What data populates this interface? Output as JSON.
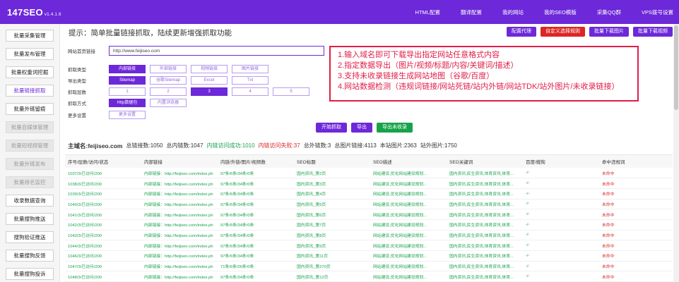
{
  "header": {
    "brand": "147SEO",
    "version": "v1.4.1.6",
    "nav": [
      "HTML配置",
      "翻译配置",
      "我的网站",
      "我的SEO模版",
      "采集QQ群",
      "VPS拨号设置"
    ]
  },
  "sidebar": {
    "items": [
      {
        "label": "批量采集管理",
        "state": "normal"
      },
      {
        "label": "批量发布管理",
        "state": "normal"
      },
      {
        "label": "批量权重词挖掘",
        "state": "normal"
      },
      {
        "label": "批量链接抓取",
        "state": "active"
      },
      {
        "label": "批量外链留痕",
        "state": "normal"
      },
      {
        "label": "批量自媒体管理",
        "state": "disabled"
      },
      {
        "label": "批量短视频管理",
        "state": "disabled"
      },
      {
        "label": "批量外链发布",
        "state": "disabled"
      },
      {
        "label": "批量排名监控",
        "state": "disabled"
      },
      {
        "label": "收录数据查询",
        "state": "normal"
      },
      {
        "label": "批量搜狗推送",
        "state": "normal"
      },
      {
        "label": "搜狗验证推送",
        "state": "normal"
      },
      {
        "label": "批量搜狗反馈",
        "state": "normal"
      },
      {
        "label": "批量搜狗投诉",
        "state": "normal"
      }
    ]
  },
  "main": {
    "hint": "提示：简单批量链接抓取，陆续更新增强抓取功能",
    "actions": [
      "配置代理",
      "自定义选择规则",
      "批量下载图片",
      "批量下载视频"
    ],
    "form": {
      "url_label": "网站首页链接",
      "url_value": "http://www.feijiseo.com",
      "fetch_type_label": "抓取类型",
      "fetch_types": [
        "内部链接",
        "外部链接",
        "视频链接",
        "图片链接"
      ],
      "export_type_label": "导出类型",
      "export_types": [
        "Sitemap",
        "谷歌Sitemap",
        "Excel",
        "Txt"
      ],
      "layers_label": "抓取层数",
      "layers": [
        "1",
        "2",
        "3",
        "4",
        "5"
      ],
      "method_label": "抓取方式",
      "methods": [
        "Http数据包",
        "内置浏览器"
      ],
      "more_label": "更多设置",
      "more_button": "更多设置"
    },
    "callout": [
      "1.输入域名即可下载导出指定网站任意格式内容",
      "2.指定数据导出（图片/视频/标题/内容/关键词/描述）",
      "3.支持未收录链接生成网站地图（谷歌/百度）",
      "4.网站数据检测（违规词链接/网站死链/站内外链/网站TDK/站外图片/未收录链接）"
    ],
    "run_buttons": [
      "开始抓取",
      "导出",
      "导出未收录"
    ],
    "stats": {
      "domain": "主域名:feijiseo.com",
      "total": "总链接数:1050",
      "internal": "总内链数:1047",
      "ok": "内链访问成功:1010",
      "fail": "内链访问失败:37",
      "external": "总外链数:3",
      "images": "总图片链接:4113",
      "local_images": "本站图片:2363",
      "external_images": "站外图片:1750"
    },
    "table": {
      "columns": [
        "序号/层数/访问/状态",
        "内部链接",
        "内链/外链/图片/视频数",
        "SEO标题",
        "SEO描述",
        "SEO关键词",
        "百度/搜狗",
        "命中违规词"
      ],
      "rows": [
        [
          "1037/3/已访问/200",
          "内部链接：http://feijiseo.com/index.ph",
          "97条/6条/34条/0条",
          "国内资讯_第2页",
          "网站建设,优化网站建设规划...",
          "国内资讯,民生资讯,体育资讯,体育...",
          "-/-",
          "未命中"
        ],
        [
          "1038/3/已访问/200",
          "内部链接：http://feijiseo.com/index.ph",
          "97条/6条/34条/0条",
          "国内资讯_第3页",
          "网站建设,优化网站建设规划...",
          "国内资讯,民生资讯,体育资讯,体育...",
          "-/-",
          "未命中"
        ],
        [
          "1039/3/已访问/200",
          "内部链接：http://feijiseo.com/index.ph",
          "97条/6条/34条/0条",
          "国内资讯_第4页",
          "网站建设,优化网站建设规划...",
          "国内资讯,民生资讯,体育资讯,体育...",
          "-/-",
          "未命中"
        ],
        [
          "1040/3/已访问/200",
          "内部链接：http://feijiseo.com/index.ph",
          "97条/6条/34条/0条",
          "国内资讯_第5页",
          "网站建设,优化网站建设规划...",
          "国内资讯,民生资讯,体育资讯,体育...",
          "-/-",
          "未命中"
        ],
        [
          "1041/3/已访问/200",
          "内部链接：http://feijiseo.com/index.ph",
          "97条/6条/34条/0条",
          "国内资讯_第6页",
          "网站建设,优化网站建设规划...",
          "国内资讯,民生资讯,体育资讯,体育...",
          "-/-",
          "未命中"
        ],
        [
          "1042/3/已访问/200",
          "内部链接：http://feijiseo.com/index.ph",
          "97条/6条/34条/0条",
          "国内资讯_第7页",
          "网站建设,优化网站建设规划...",
          "国内资讯,民生资讯,体育资讯,体育...",
          "-/-",
          "未命中"
        ],
        [
          "1043/3/已访问/200",
          "内部链接：http://feijiseo.com/index.ph",
          "97条/6条/34条/0条",
          "国内资讯_第8页",
          "网站建设,优化网站建设规划...",
          "国内资讯,民生资讯,体育资讯,体育...",
          "-/-",
          "未命中"
        ],
        [
          "1044/3/已访问/200",
          "内部链接：http://feijiseo.com/index.ph",
          "97条/6条/34条/0条",
          "国内资讯_第9页",
          "网站建设,优化网站建设规划...",
          "国内资讯,民生资讯,体育资讯,体育...",
          "-/-",
          "未命中"
        ],
        [
          "1046/3/已访问/200",
          "内部链接：http://feijiseo.com/index.ph",
          "97条/6条/34条/0条",
          "国内资讯_第11页",
          "网站建设,优化网站建设规划...",
          "国内资讯,民生资讯,体育资讯,体育...",
          "-/-",
          "未命中"
        ],
        [
          "1047/3/已访问/200",
          "内部链接：http://feijiseo.com/index.ph",
          "71条/6条/26条/0条",
          "国内资讯_第270页",
          "网站建设,优化网站建设规划...",
          "国内资讯,民生资讯,体育资讯,体育...",
          "-/-",
          "未命中"
        ],
        [
          "1048/3/已访问/200",
          "内部链接：http://feijiseo.com/index.ph",
          "97条/6条/34条/0条",
          "国内资讯_第12页",
          "网站建设,优化网站建设规划...",
          "国内资讯,民生资讯,体育资讯,体育...",
          "-/-",
          "未命中"
        ]
      ]
    }
  },
  "colors": {
    "accent": "#6d28d9",
    "success": "#16a34a",
    "danger": "#dc2626"
  }
}
